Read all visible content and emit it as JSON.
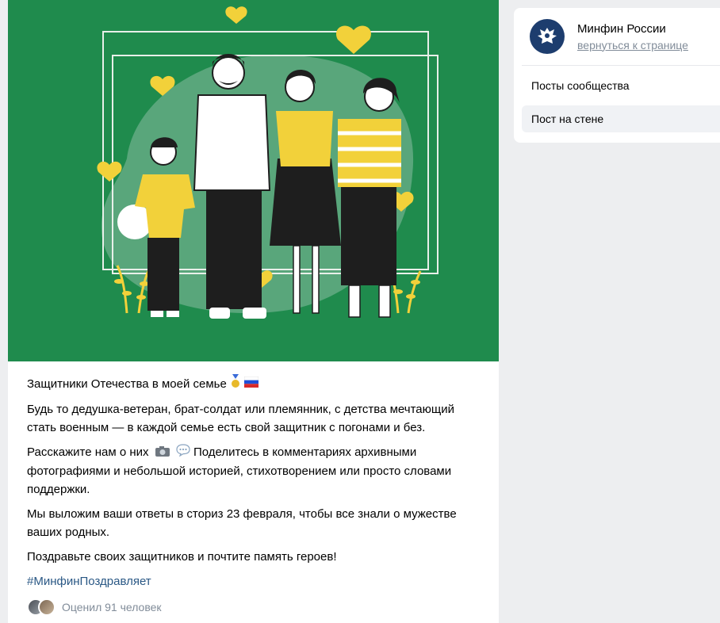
{
  "group": {
    "name": "Минфин России",
    "back_link": "вернуться к странице"
  },
  "nav": {
    "items": [
      {
        "label": "Посты сообщества"
      },
      {
        "label": "Пост на стене"
      }
    ]
  },
  "post": {
    "title": "Защитники Отечества в моей семье",
    "paragraphs": [
      "Будь то дедушка-ветеран, брат-солдат или племянник, с детства мечтающий стать военным — в каждой семье есть свой защитник с погонами и без.",
      "Расскажите нам о них",
      "Поделитесь в комментариях архивными фотографиями и небольшой историей, стихотворением или просто словами поддержки.",
      "Мы выложим ваши ответы в сториз 23 февраля, чтобы все знали о мужестве ваших родных.",
      "Поздравьте своих защитников и почтите память героев!"
    ],
    "hashtag": "#МинфинПоздравляет",
    "likes_text": "Оценил 91 человек"
  },
  "colors": {
    "image_background": "#1f8b4d",
    "link": "#2a5885",
    "muted": "#818c99",
    "accent_yellow": "#f2d13a"
  }
}
